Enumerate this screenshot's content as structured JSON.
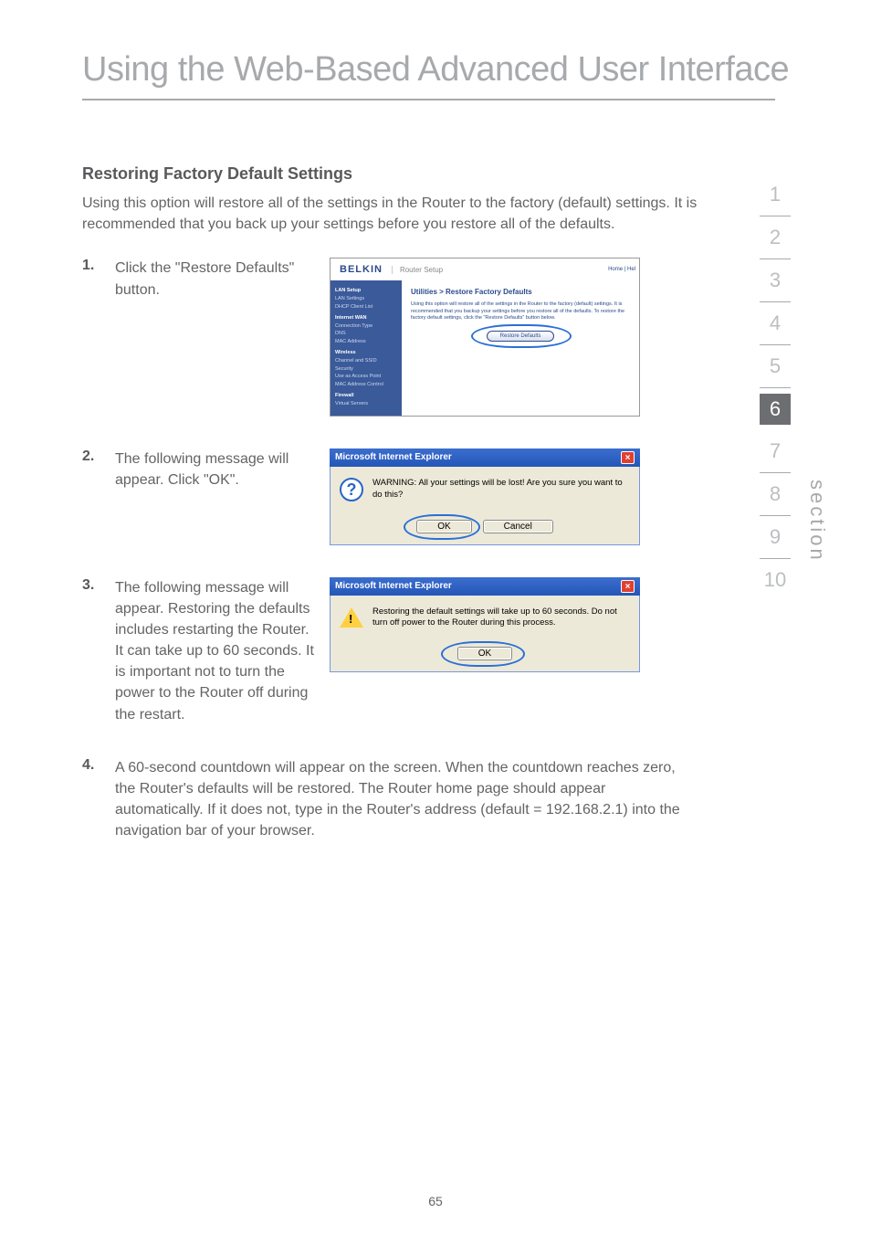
{
  "page_title": "Using the Web-Based Advanced User Interface",
  "heading": "Restoring Factory Default Settings",
  "intro": "Using this option will restore all of the settings in the Router to the factory (default) settings. It is recommended that you back up your settings before you restore all of the defaults.",
  "steps": {
    "s1": {
      "num": "1.",
      "text": "Click the \"Restore Defaults\" button."
    },
    "s2": {
      "num": "2.",
      "text": "The following message will appear. Click \"OK\"."
    },
    "s3": {
      "num": "3.",
      "text": "The following message will appear. Restoring the defaults includes restarting the Router. It can take up to 60 seconds. It is important not to turn the power to the Router off during the restart."
    },
    "s4": {
      "num": "4.",
      "text": "A 60-second countdown will appear on the screen. When the countdown reaches zero, the Router's defaults will be restored. The Router home page should appear automatically. If it does not, type in the Router's address (default = 192.168.2.1) into the navigation bar of your browser."
    }
  },
  "belkin": {
    "logo": "BELKIN",
    "router_setup": "Router Setup",
    "home": "Home | Hel",
    "crumb": "Utilities > Restore Factory Defaults",
    "desc": "Using this option will restore all of the settings in the Router to the factory (default) settings. It is recommended that you backup your settings before you restore all of the defaults. To restore the factory default settings, click the \"Restore Defaults\" button below.",
    "restore_btn": "Restore Defaults",
    "nav": {
      "g1": "LAN Setup",
      "i1a": "LAN Settings",
      "i1b": "DHCP Client List",
      "g2": "Internet WAN",
      "i2a": "Connection Type",
      "i2b": "DNS",
      "i2c": "MAC Address",
      "g3": "Wireless",
      "i3a": "Channel and SSID",
      "i3b": "Security",
      "i3c": "Use as Access Point",
      "i3d": "MAC Address Control",
      "g4": "Firewall",
      "i4a": "Virtual Servers"
    }
  },
  "dialog2": {
    "title": "Microsoft Internet Explorer",
    "msg": "WARNING: All your settings will be lost! Are you sure you want to do this?",
    "ok": "OK",
    "cancel": "Cancel"
  },
  "dialog3": {
    "title": "Microsoft Internet Explorer",
    "msg": "Restoring the default settings will take up to 60 seconds. Do not turn off power to the Router during this process.",
    "ok": "OK"
  },
  "sidenav": [
    "1",
    "2",
    "3",
    "4",
    "5",
    "6",
    "7",
    "8",
    "9",
    "10"
  ],
  "sidenav_active_index": 5,
  "section_label": "section",
  "page_number": "65"
}
